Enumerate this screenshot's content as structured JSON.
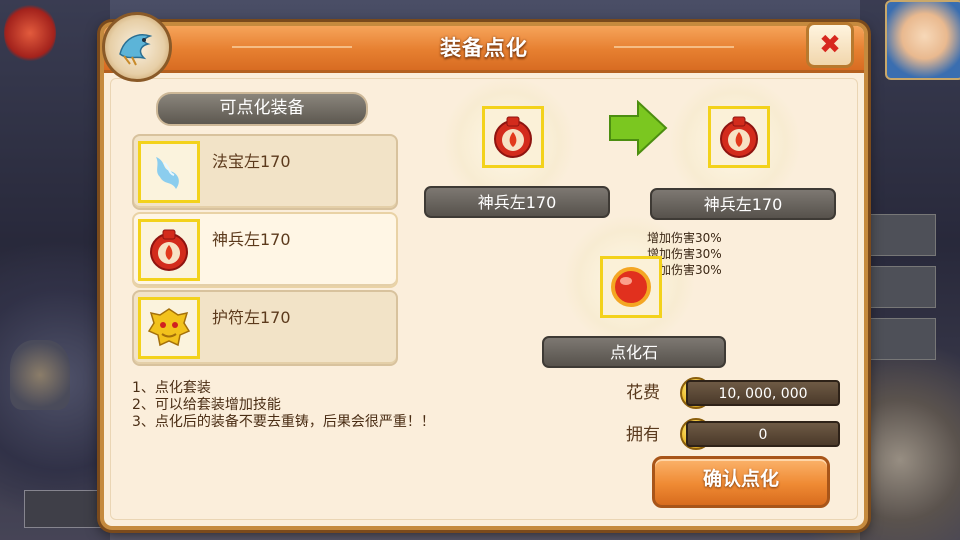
{
  "dialog": {
    "title": "装备点化",
    "emblem_icon": "qilin-emblem-icon",
    "close_icon": "close-x-icon"
  },
  "equipment_list": {
    "header": "可点化装备",
    "items": [
      {
        "name": "法宝左170",
        "icon": "blue-spirit-treasure-icon",
        "selected": false
      },
      {
        "name": "神兵左170",
        "icon": "red-fire-ring-icon",
        "selected": true
      },
      {
        "name": "护符左170",
        "icon": "golden-lion-talisman-icon",
        "selected": false
      }
    ]
  },
  "notes": [
    "1、点化套装",
    "2、可以给套装增加技能",
    "3、点化后的装备不要去重铸，后果会很严重！！"
  ],
  "transform": {
    "source_name": "神兵左170",
    "result_name": "神兵左170",
    "arrow_icon": "green-arrow-right-icon",
    "bonuses": [
      "增加伤害30%",
      "增加伤害30%",
      "增加伤害30%"
    ]
  },
  "material": {
    "name": "点化石",
    "icon": "red-orb-stone-icon"
  },
  "cost": {
    "cost_label": "花费",
    "cost_value": "10, 000, 000",
    "owned_label": "拥有",
    "owned_value": "0",
    "coin_icon": "gold-coin-icon"
  },
  "confirm_label": "确认点化",
  "colors": {
    "accent_orange": "#e67f30",
    "slot_border": "#f3d21b",
    "arrow_green": "#7bc720",
    "close_red": "#d7271e"
  }
}
